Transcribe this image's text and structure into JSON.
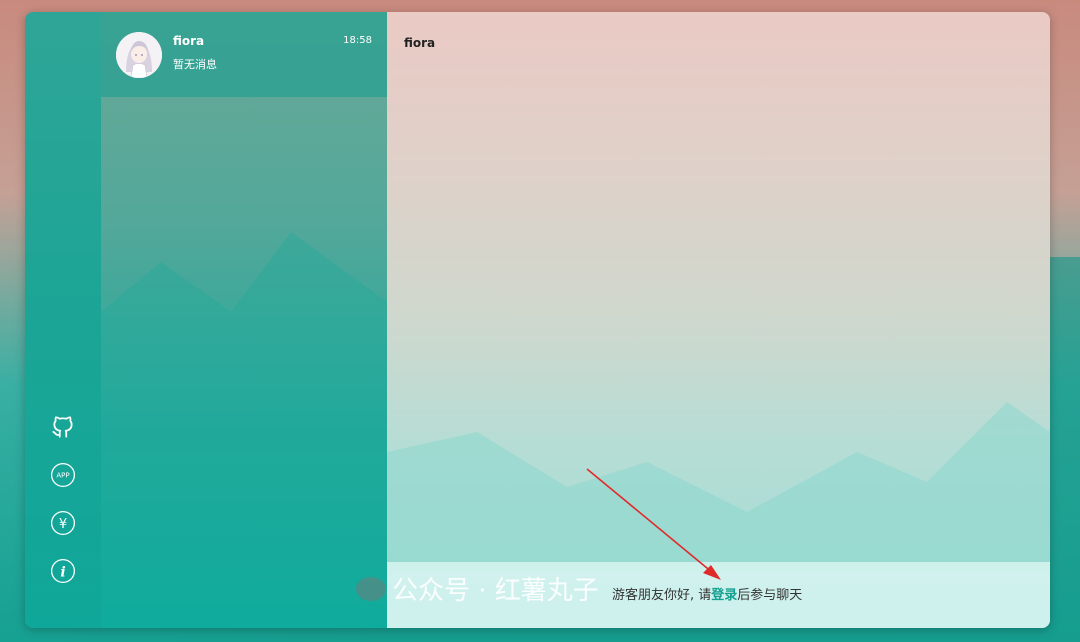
{
  "sidebar": {
    "icons": [
      {
        "name": "github-icon"
      },
      {
        "name": "app-icon",
        "label": "APP"
      },
      {
        "name": "yen-icon",
        "label": "¥"
      },
      {
        "name": "info-icon",
        "label": "i"
      }
    ]
  },
  "chat_list": {
    "items": [
      {
        "name": "fiora",
        "time": "18:58",
        "preview": "暂无消息"
      }
    ]
  },
  "chat": {
    "title": "fiora",
    "guest_prefix": "游客朋友你好, 请",
    "login_label": "登录",
    "guest_suffix": "后参与聊天"
  },
  "watermark": {
    "text": "公众号 · 红薯丸子"
  },
  "colors": {
    "accent": "#14a090",
    "arrow": "#e02a2a"
  }
}
